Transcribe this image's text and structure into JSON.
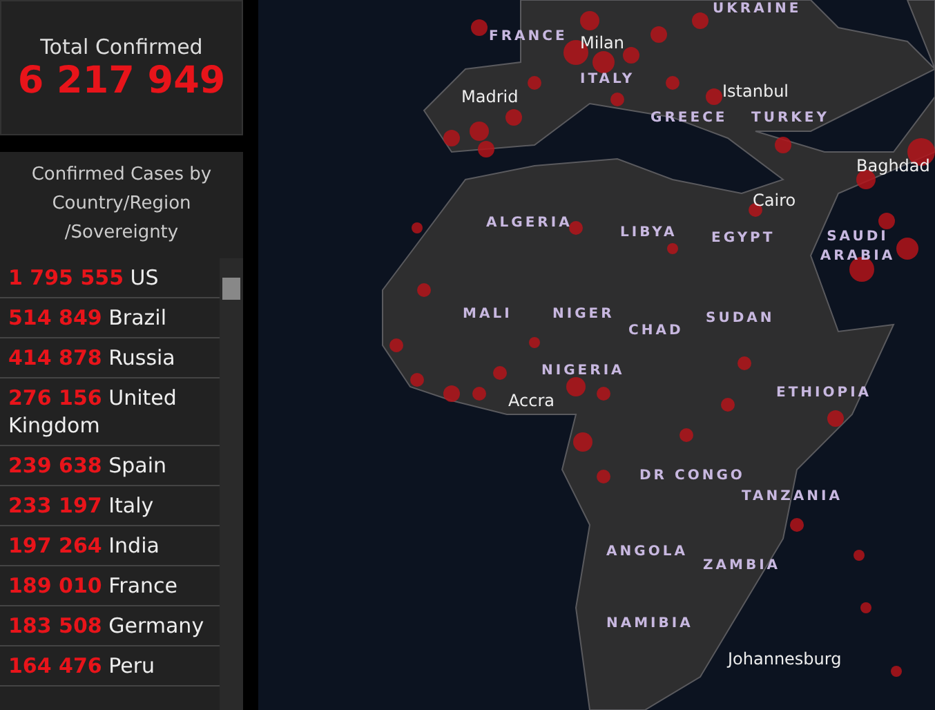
{
  "total": {
    "label": "Total Confirmed",
    "value": "6 217 949"
  },
  "cases": {
    "title": "Confirmed Cases by Country/Region /Sovereignty",
    "rows": [
      {
        "count": "1 795 555",
        "place": "US"
      },
      {
        "count": "514 849",
        "place": "Brazil"
      },
      {
        "count": "414 878",
        "place": "Russia"
      },
      {
        "count": "276 156",
        "place": "United Kingdom"
      },
      {
        "count": "239 638",
        "place": "Spain"
      },
      {
        "count": "233 197",
        "place": "Italy"
      },
      {
        "count": "197 264",
        "place": "India"
      },
      {
        "count": "189 010",
        "place": "France"
      },
      {
        "count": "183 508",
        "place": "Germany"
      },
      {
        "count": "164 476",
        "place": "Peru"
      }
    ]
  },
  "map": {
    "labels": [
      {
        "text": "UKRAINE",
        "kind": "country"
      },
      {
        "text": "FRANCE",
        "kind": "country"
      },
      {
        "text": "Milan",
        "kind": "city"
      },
      {
        "text": "Madrid",
        "kind": "city"
      },
      {
        "text": "ITALY",
        "kind": "country"
      },
      {
        "text": "Istanbul",
        "kind": "city"
      },
      {
        "text": "GREECE",
        "kind": "country"
      },
      {
        "text": "TURKEY",
        "kind": "country"
      },
      {
        "text": "Baghdad",
        "kind": "city"
      },
      {
        "text": "Cairo",
        "kind": "city"
      },
      {
        "text": "ALGERIA",
        "kind": "country"
      },
      {
        "text": "LIBYA",
        "kind": "country"
      },
      {
        "text": "EGYPT",
        "kind": "country"
      },
      {
        "text": "SAUDI ARABIA",
        "kind": "country"
      },
      {
        "text": "MALI",
        "kind": "country"
      },
      {
        "text": "NIGER",
        "kind": "country"
      },
      {
        "text": "CHAD",
        "kind": "country"
      },
      {
        "text": "SUDAN",
        "kind": "country"
      },
      {
        "text": "NIGERIA",
        "kind": "country"
      },
      {
        "text": "Accra",
        "kind": "city"
      },
      {
        "text": "ETHIOPIA",
        "kind": "country"
      },
      {
        "text": "DR CONGO",
        "kind": "country"
      },
      {
        "text": "TANZANIA",
        "kind": "country"
      },
      {
        "text": "ANGOLA",
        "kind": "country"
      },
      {
        "text": "ZAMBIA",
        "kind": "country"
      },
      {
        "text": "NAMIBIA",
        "kind": "country"
      },
      {
        "text": "Johannesburg",
        "kind": "city"
      }
    ]
  }
}
